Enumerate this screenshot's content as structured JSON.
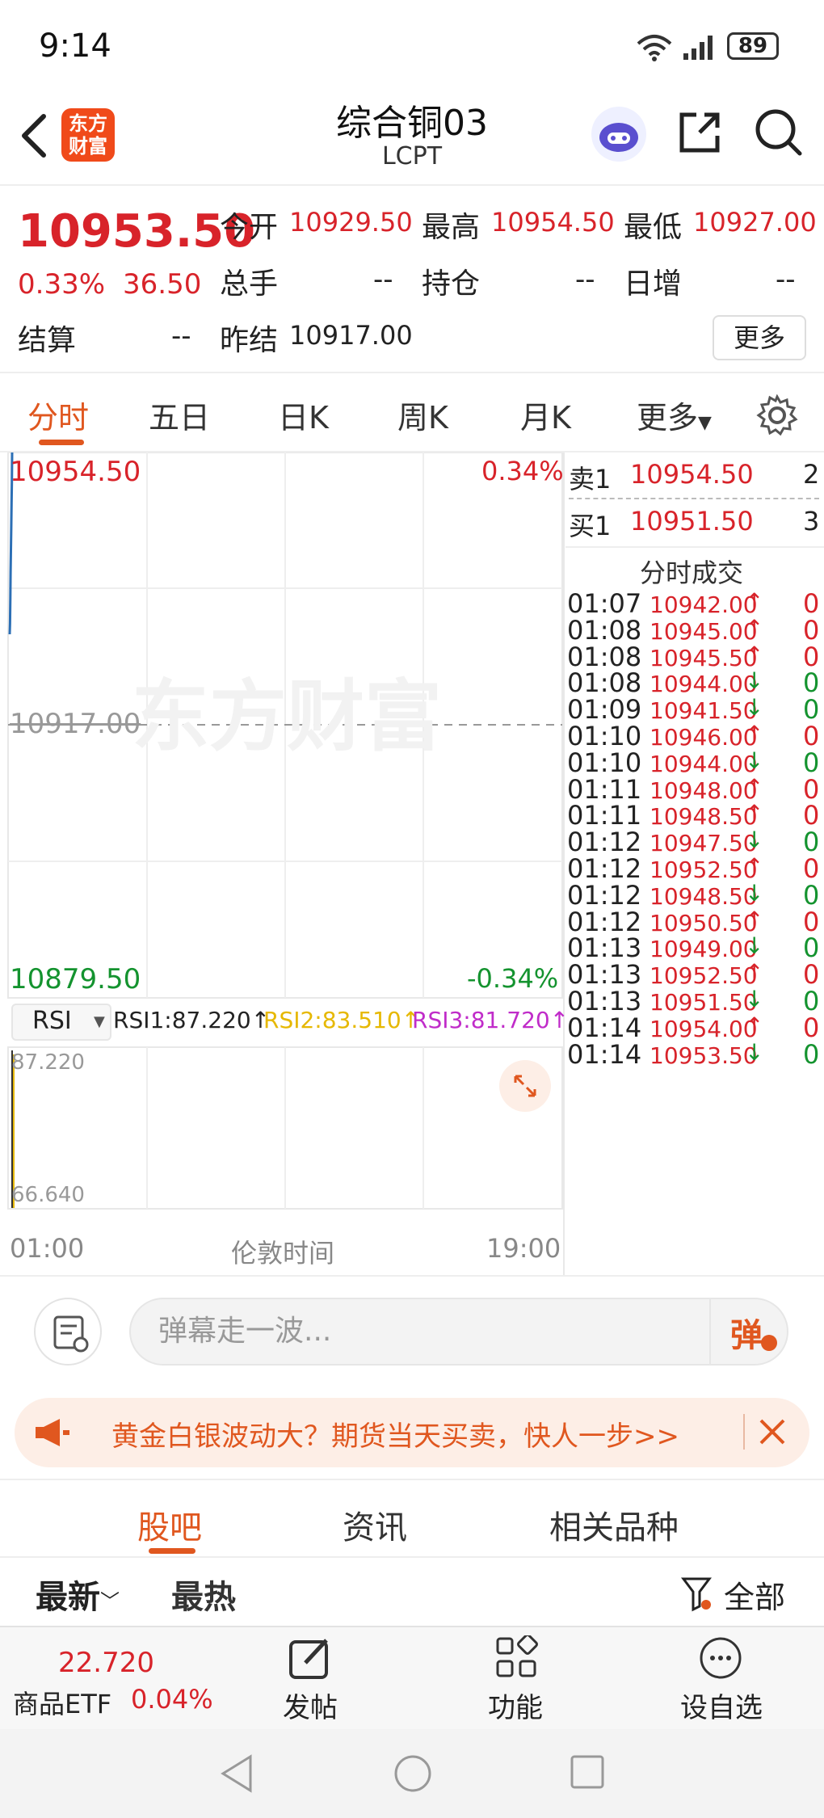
{
  "status_bar": {
    "time": "9:14",
    "battery": "89"
  },
  "header": {
    "title": "综合铜03",
    "subtitle": "LCPT",
    "logo_line1": "东方",
    "logo_line2": "财富"
  },
  "quote": {
    "price": "10953.50",
    "change_pct": "0.33%",
    "change": "36.50",
    "open_label": "今开",
    "open": "10929.50",
    "high_label": "最高",
    "high": "10954.50",
    "low_label": "最低",
    "low": "10927.00",
    "volume_label": "总手",
    "volume": "--",
    "position_label": "持仓",
    "position": "--",
    "daily_inc_label": "日增",
    "daily_inc": "--",
    "settle_label": "结算",
    "settle": "--",
    "prev_settle_label": "昨结",
    "prev_settle": "10917.00",
    "more_button": "更多"
  },
  "tabs": {
    "items": [
      "分时",
      "五日",
      "日K",
      "周K",
      "月K",
      "更多"
    ],
    "active": "分时"
  },
  "chart": {
    "watermark": "东方财富",
    "top_price": "10954.50",
    "top_pct": "0.34%",
    "mid_price": "10917.00",
    "bottom_price": "10879.50",
    "bottom_pct": "-0.34%",
    "indicator_name": "RSI",
    "rsi1": "RSI1:87.220↑",
    "rsi2": "RSI2:83.510↑",
    "rsi3": "RSI3:81.720↑",
    "rsi_top": "87.220",
    "rsi_bottom": "66.640",
    "x_start": "01:00",
    "x_mid": "伦敦时间",
    "x_end": "19:00"
  },
  "chart_data": {
    "type": "line",
    "title": "",
    "series": [
      {
        "name": "",
        "x": [
          "01:00",
          "01:01",
          "01:02",
          "01:03",
          "01:04",
          "01:05",
          "01:06",
          "01:07",
          "01:08"
        ],
        "values": [
          10929.5,
          10931.0,
          10934.5,
          10938.0,
          10941.0,
          10944.0,
          10947.5,
          10950.5,
          10954.5
        ]
      }
    ],
    "ylim": [
      10879.5,
      10954.5
    ],
    "ref_line": 10917.0,
    "x_range": [
      "01:00",
      "19:00"
    ]
  },
  "orderbook": {
    "ask_label": "卖1",
    "ask_price": "10954.50",
    "ask_qty": "2",
    "bid_label": "买1",
    "bid_price": "10951.50",
    "bid_qty": "3",
    "trades_title": "分时成交"
  },
  "trades": [
    {
      "time": "01:07",
      "price": "10942.00",
      "dir": "↑",
      "vol": "0",
      "up": true
    },
    {
      "time": "01:08",
      "price": "10945.00",
      "dir": "↑",
      "vol": "0",
      "up": true
    },
    {
      "time": "01:08",
      "price": "10945.50",
      "dir": "↑",
      "vol": "0",
      "up": true
    },
    {
      "time": "01:08",
      "price": "10944.00",
      "dir": "↓",
      "vol": "0",
      "up": false
    },
    {
      "time": "01:09",
      "price": "10941.50",
      "dir": "↓",
      "vol": "0",
      "up": false
    },
    {
      "time": "01:10",
      "price": "10946.00",
      "dir": "↑",
      "vol": "0",
      "up": true
    },
    {
      "time": "01:10",
      "price": "10944.00",
      "dir": "↓",
      "vol": "0",
      "up": false
    },
    {
      "time": "01:11",
      "price": "10948.00",
      "dir": "↑",
      "vol": "0",
      "up": true
    },
    {
      "time": "01:11",
      "price": "10948.50",
      "dir": "↑",
      "vol": "0",
      "up": true
    },
    {
      "time": "01:12",
      "price": "10947.50",
      "dir": "↓",
      "vol": "0",
      "up": false
    },
    {
      "time": "01:12",
      "price": "10952.50",
      "dir": "↑",
      "vol": "0",
      "up": true
    },
    {
      "time": "01:12",
      "price": "10948.50",
      "dir": "↓",
      "vol": "0",
      "up": false
    },
    {
      "time": "01:12",
      "price": "10950.50",
      "dir": "↑",
      "vol": "0",
      "up": true
    },
    {
      "time": "01:13",
      "price": "10949.00",
      "dir": "↓",
      "vol": "0",
      "up": false
    },
    {
      "time": "01:13",
      "price": "10952.50",
      "dir": "↑",
      "vol": "0",
      "up": true
    },
    {
      "time": "01:13",
      "price": "10951.50",
      "dir": "↓",
      "vol": "0",
      "up": false
    },
    {
      "time": "01:14",
      "price": "10954.00",
      "dir": "↑",
      "vol": "0",
      "up": true
    },
    {
      "time": "01:14",
      "price": "10953.50",
      "dir": "↓",
      "vol": "0",
      "up": false
    }
  ],
  "danmu": {
    "placeholder": "弹幕走一波...",
    "send_label": "弹"
  },
  "promo": {
    "text": "黄金白银波动大？期货当天买卖，快人一步>>"
  },
  "sub_tabs": {
    "items": [
      "股吧",
      "资讯",
      "相关品种"
    ],
    "active": "股吧"
  },
  "sort": {
    "latest": "最新",
    "hottest": "最热",
    "filter": "全部"
  },
  "bottom_nav": {
    "etf_price": "22.720",
    "etf_name": "商品ETF",
    "etf_pct": "0.04%",
    "post": "发帖",
    "functions": "功能",
    "watchlist": "设自选"
  },
  "colors": {
    "up": "#d8232a",
    "down": "#14932f",
    "accent": "#e0571f",
    "line": "#2c6fb5",
    "rsi2": "#e6b800",
    "rsi3": "#c02cc9"
  }
}
